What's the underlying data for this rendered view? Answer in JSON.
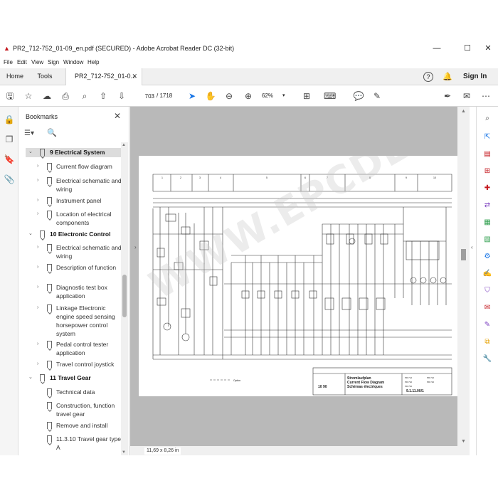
{
  "window": {
    "title": "PR2_712-752_01-09_en.pdf (SECURED) - Adobe Acrobat Reader DC (32-bit)",
    "controls": {
      "minimize": "—",
      "maximize": "☐",
      "close": "✕"
    }
  },
  "menu": [
    "File",
    "Edit",
    "View",
    "Sign",
    "Window",
    "Help"
  ],
  "tabs": {
    "home": "Home",
    "tools": "Tools",
    "document": "PR2_712-752_01-0..."
  },
  "account": {
    "sign_in": "Sign In"
  },
  "toolbar": {
    "page_current": "703",
    "page_total": "/ 1718",
    "zoom": "62%"
  },
  "bookmarks": {
    "title": "Bookmarks",
    "items": [
      {
        "label": "9 Electrical System",
        "level": 0,
        "expanded": true,
        "selected": true
      },
      {
        "label": "Current flow diagram",
        "level": 1,
        "expandable": true
      },
      {
        "label": "Electrical schematic and wiring",
        "level": 1,
        "expandable": true
      },
      {
        "label": "Instrument panel",
        "level": 1,
        "expandable": true
      },
      {
        "label": "Location of electrical components",
        "level": 1,
        "expandable": true
      },
      {
        "label": "10 Electronic Control",
        "level": 0,
        "expanded": true
      },
      {
        "label": "Electrical schematic and wiring",
        "level": 1,
        "expandable": true
      },
      {
        "label": "Description of function",
        "level": 1,
        "expandable": true
      },
      {
        "label": "Diagnostic test box application",
        "level": 1,
        "expandable": true
      },
      {
        "label": "Linkage Electronic engine speed sensing horsepower control system",
        "level": 1,
        "expandable": true
      },
      {
        "label": "Pedal control tester application",
        "level": 1,
        "expandable": true
      },
      {
        "label": "Travel control joystick",
        "level": 1,
        "expandable": true
      },
      {
        "label": "11 Travel Gear",
        "level": 0,
        "expanded": true
      },
      {
        "label": "Technical data",
        "level": 1,
        "expandable": false
      },
      {
        "label": "Construction, function travel gear",
        "level": 1,
        "expandable": false
      },
      {
        "label": "Remove and install",
        "level": 1,
        "expandable": false
      },
      {
        "label": "11.3.10 Travel gear type A",
        "level": 1,
        "expandable": false
      }
    ]
  },
  "document": {
    "page_size": "11,69 x 8,26 in",
    "watermark": "WWW.EPCDEPO.COM",
    "schematic": {
      "columns": [
        "1",
        "2",
        "3",
        "4",
        "5",
        "6",
        "7",
        "8",
        "9",
        "10"
      ],
      "option_label": "Option",
      "title_block": {
        "heading": "Stromlaufplan",
        "heading_en": "Current Flow Diagram",
        "heading_fr": "Schémas électriques",
        "date": "10 90",
        "doc_no": "9.1.11.00/1",
        "models": [
          "PR 712",
          "PR 722",
          "PR 732",
          "PR 742",
          "PR 752"
        ]
      }
    }
  },
  "colors": {
    "accent": "#1473e6",
    "app_red": "#c4161c",
    "doc_background": "#b9b9b9"
  }
}
